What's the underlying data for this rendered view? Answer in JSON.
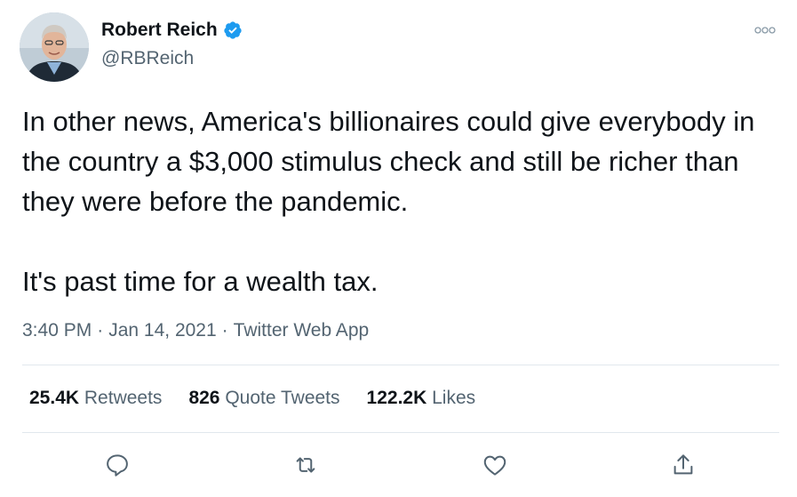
{
  "author": {
    "display_name": "Robert Reich",
    "handle": "@RBReich",
    "verified": true
  },
  "tweet": {
    "paragraphs": [
      "In other news, America's billionaires could give everybody in the country a $3,000 stimulus check and still be richer than they were before the pandemic.",
      "It's past time for a wealth tax."
    ],
    "time": "3:40 PM",
    "date": "Jan 14, 2021",
    "source": "Twitter Web App",
    "separator": "·"
  },
  "stats": {
    "retweets": {
      "count": "25.4K",
      "label": "Retweets"
    },
    "quotes": {
      "count": "826",
      "label": "Quote Tweets"
    },
    "likes": {
      "count": "122.2K",
      "label": "Likes"
    }
  },
  "actions": [
    "reply-icon",
    "retweet-icon",
    "like-icon",
    "share-icon"
  ],
  "colors": {
    "text": "#0f1419",
    "secondary": "#536471",
    "verified": "#1d9bf0",
    "divider": "#e1e8ed"
  }
}
